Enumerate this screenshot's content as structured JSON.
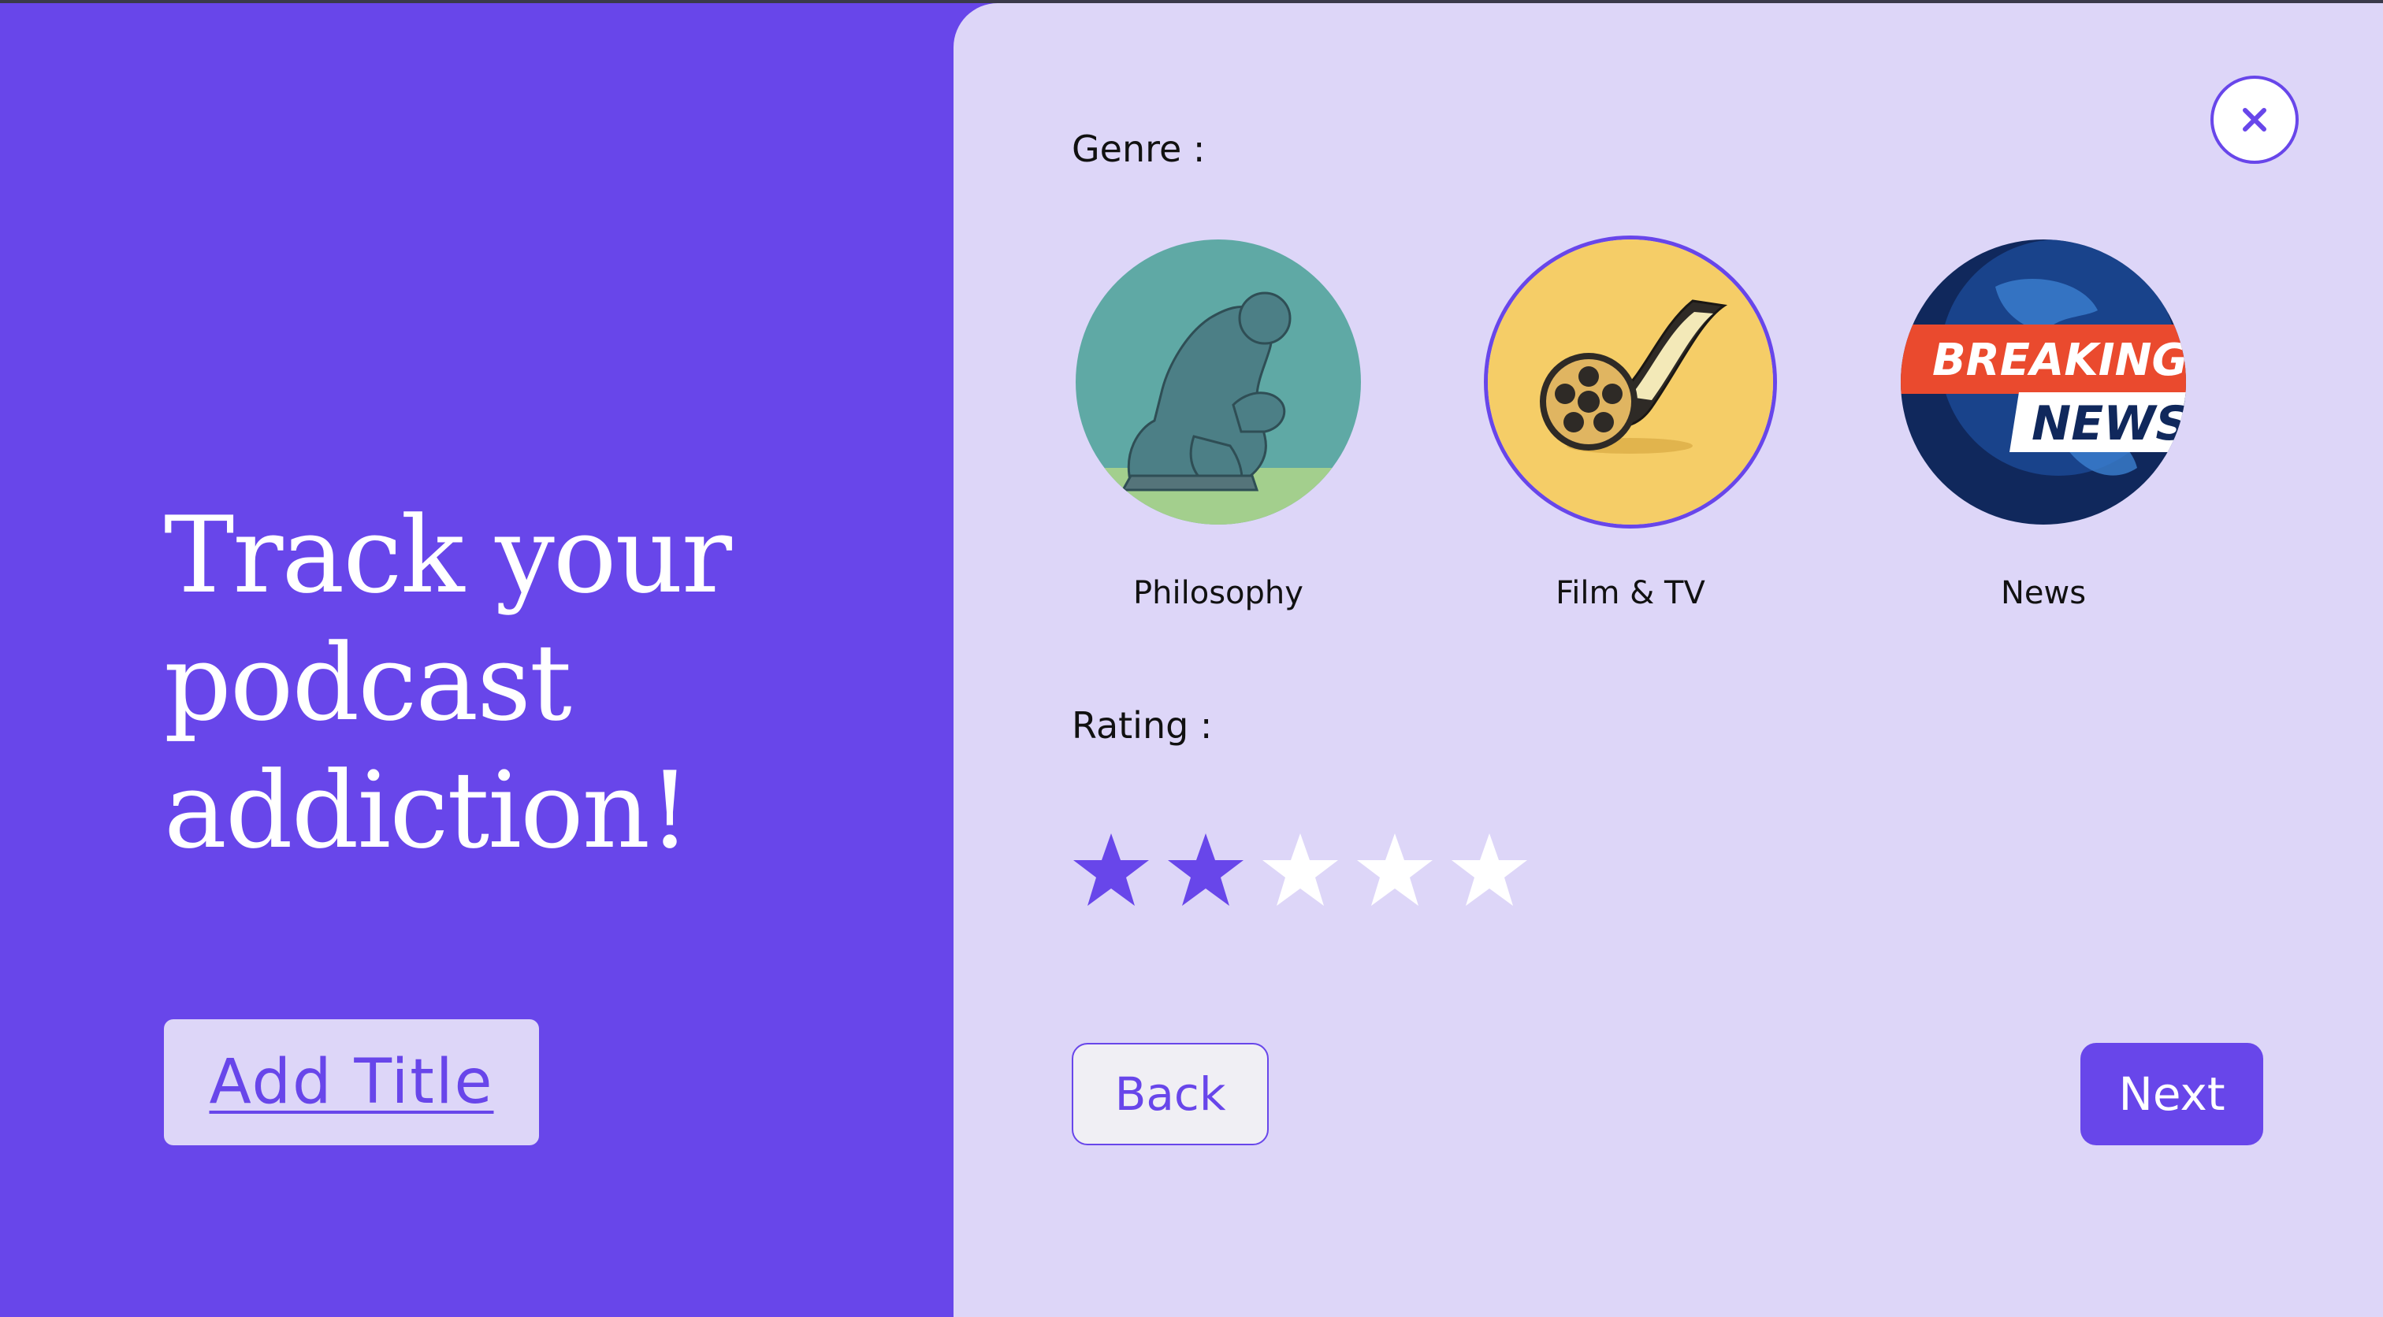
{
  "hero": {
    "headline_lines": [
      "Track your",
      "podcast",
      "addiction!"
    ],
    "add_title_label": "Add Title"
  },
  "panel": {
    "genre_label": "Genre :",
    "genres": [
      {
        "label": "Philosophy",
        "icon": "thinker-statue-icon",
        "selected": false
      },
      {
        "label": "Film & TV",
        "icon": "film-reel-icon",
        "selected": true
      },
      {
        "label": "News",
        "icon": "breaking-news-icon",
        "selected": false,
        "art_text": [
          "BREAKING",
          "NEWS"
        ]
      }
    ],
    "rating_label": "Rating :",
    "rating": {
      "value": 2,
      "max": 5
    },
    "back_label": "Back",
    "next_label": "Next",
    "close_icon": "close-icon"
  },
  "colors": {
    "accent": "#6846ea",
    "panel_bg": "#ddd6f8",
    "star_empty": "#ffffff"
  }
}
